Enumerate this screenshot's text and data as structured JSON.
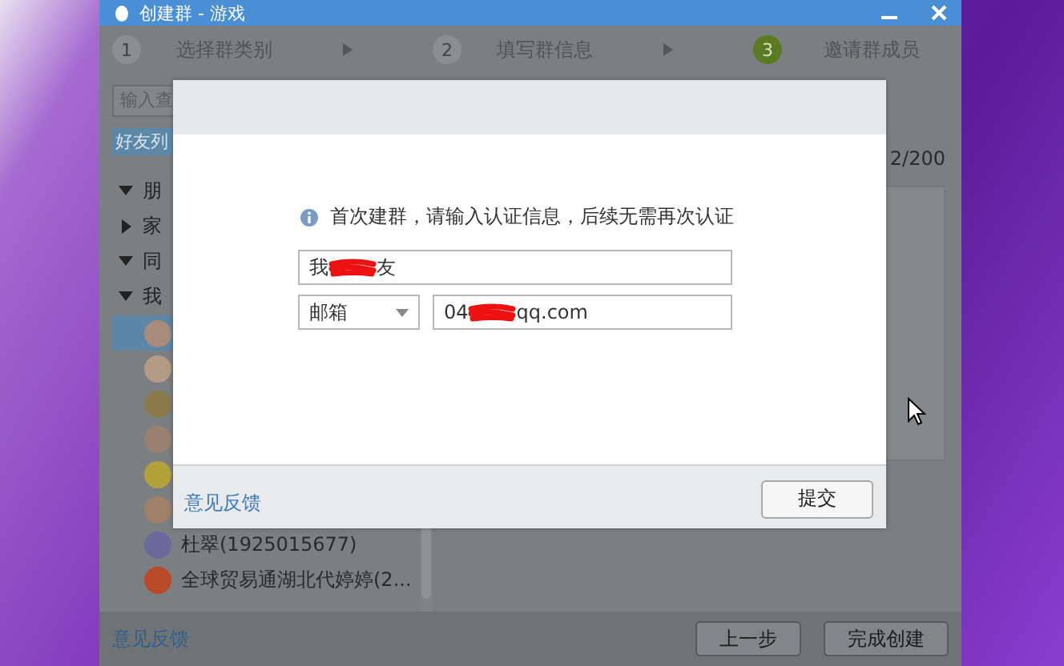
{
  "window": {
    "title": "创建群 - 游戏"
  },
  "steps": [
    {
      "number": "1",
      "label": "选择群类别",
      "selected": false
    },
    {
      "number": "2",
      "label": "填写群信息",
      "selected": false
    },
    {
      "number": "3",
      "label": "邀请群成员",
      "selected": true
    }
  ],
  "friend_panel": {
    "search": {
      "placeholder": "输入查"
    },
    "tab": "好友列",
    "groups": [
      {
        "label": "朋",
        "expanded": true
      },
      {
        "label": "家",
        "expanded": false
      },
      {
        "label": "同",
        "expanded": true
      },
      {
        "label": "我",
        "expanded": true
      }
    ],
    "contacts": [
      {
        "selected": true
      },
      {
        "selected": false
      },
      {
        "selected": false
      },
      {
        "selected": false
      },
      {
        "selected": false
      },
      {
        "selected": false
      },
      {
        "name": "杜翠(1925015677)",
        "selected": false
      },
      {
        "name": "全球贸易通湖北代婷婷(2...",
        "selected": false
      }
    ]
  },
  "member_count": "2/200",
  "dialog": {
    "notice": "首次建群，请输入认证信息，后续无需再次认证",
    "name_field": {
      "value_start": "我",
      "value_end": "友",
      "redacted": true
    },
    "contact_type": {
      "value": "邮箱"
    },
    "contact_field": {
      "value_start": "04",
      "value_end": "qq.com",
      "redacted": true
    },
    "feedback_link": "意见反馈",
    "submit_button": "提交"
  },
  "footer": {
    "feedback_link": "意见反馈",
    "buttons": [
      "上一步",
      "完成创建"
    ]
  }
}
